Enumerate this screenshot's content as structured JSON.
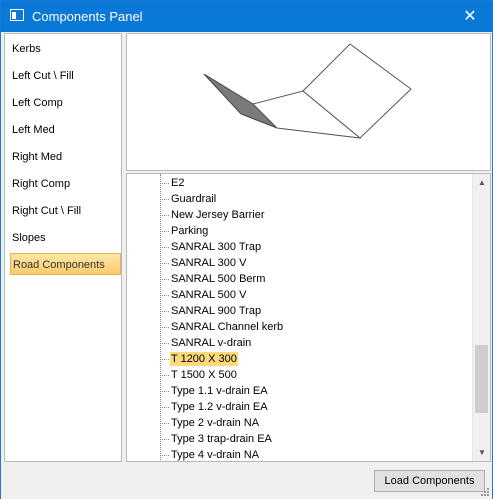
{
  "window": {
    "title": "Components Panel",
    "close_glyph": "✕"
  },
  "left_list": {
    "items": [
      {
        "label": "Kerbs"
      },
      {
        "label": "Left Cut \\ Fill"
      },
      {
        "label": "Left Comp"
      },
      {
        "label": "Left Med"
      },
      {
        "label": "Right Med"
      },
      {
        "label": "Right Comp"
      },
      {
        "label": "Right Cut \\ Fill"
      },
      {
        "label": "Slopes"
      },
      {
        "label": "Road Components"
      }
    ],
    "selected": "Road Components"
  },
  "tree": {
    "items": [
      {
        "label": "E2"
      },
      {
        "label": "Guardrail"
      },
      {
        "label": "New Jersey Barrier"
      },
      {
        "label": "Parking"
      },
      {
        "label": "SANRAL 300 Trap"
      },
      {
        "label": "SANRAL 300 V"
      },
      {
        "label": "SANRAL 500 Berm"
      },
      {
        "label": "SANRAL 500 V"
      },
      {
        "label": "SANRAL 900 Trap"
      },
      {
        "label": "SANRAL Channel kerb"
      },
      {
        "label": "SANRAL v-drain"
      },
      {
        "label": "T 1200 X 300"
      },
      {
        "label": "T 1500 X 500"
      },
      {
        "label": "Type 1.1 v-drain EA"
      },
      {
        "label": "Type 1.2 v-drain EA"
      },
      {
        "label": "Type 2 v-drain NA"
      },
      {
        "label": "Type 3 trap-drain EA"
      },
      {
        "label": "Type 4 v-drain NA"
      }
    ],
    "selected": "T 1200 X 300"
  },
  "scrollbar": {
    "up_glyph": "▲",
    "down_glyph": "▼"
  },
  "footer": {
    "load_button_label": "Load Components"
  },
  "colors": {
    "titlebar": "#0a78d7",
    "selection": "#fcd97a"
  }
}
